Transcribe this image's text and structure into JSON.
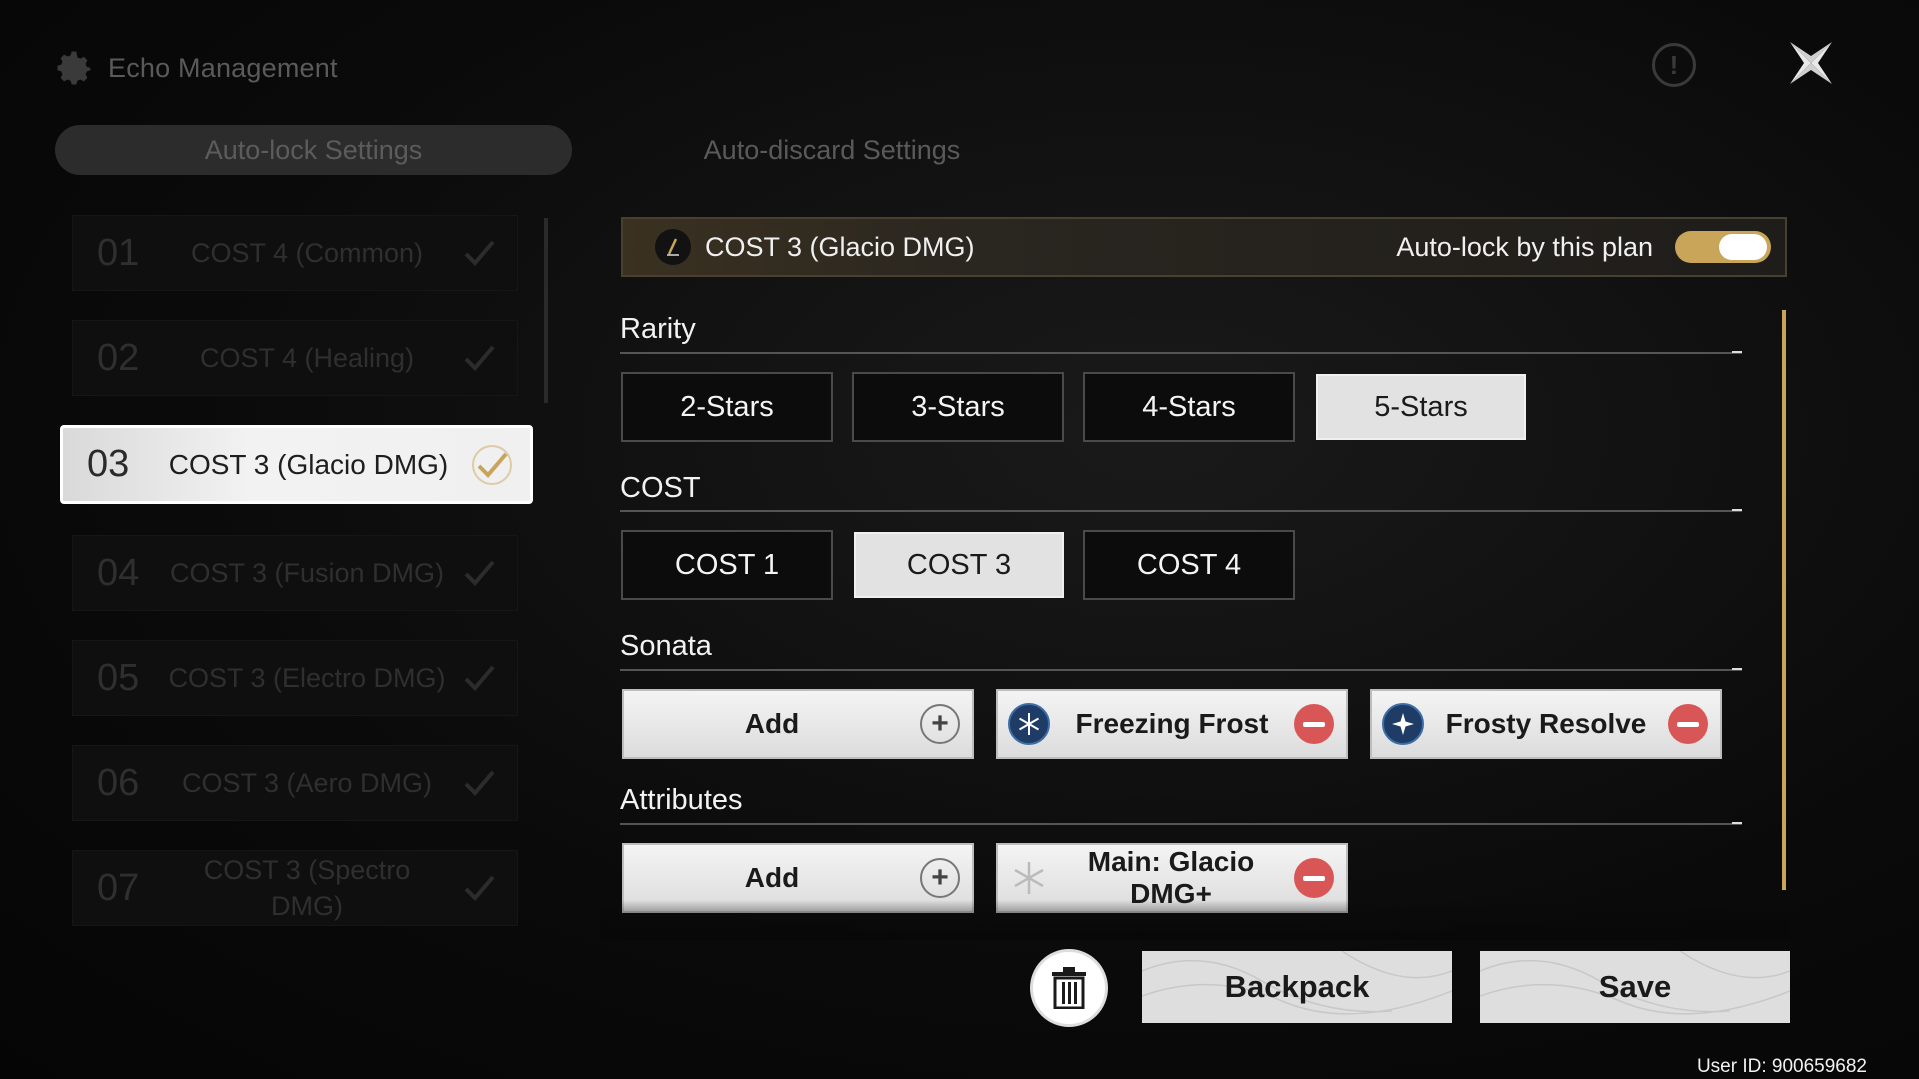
{
  "header": {
    "title": "Echo Management",
    "icon": "gear-icon"
  },
  "tabs": [
    {
      "label": "Auto-lock Settings",
      "active": true
    },
    {
      "label": "Auto-discard Settings",
      "active": false
    }
  ],
  "plans": [
    {
      "num": "01",
      "name": "COST 4 (Common)"
    },
    {
      "num": "02",
      "name": "COST 4 (Healing)"
    },
    {
      "num": "03",
      "name": "COST 3 (Glacio DMG)",
      "active": true
    },
    {
      "num": "04",
      "name": "COST 3 (Fusion DMG)"
    },
    {
      "num": "05",
      "name": "COST 3 (Electro DMG)"
    },
    {
      "num": "06",
      "name": "COST 3 (Aero DMG)"
    },
    {
      "num": "07",
      "name": "COST 3 (Spectro DMG)"
    }
  ],
  "plan_bar": {
    "name": "COST 3 (Glacio DMG)",
    "autolock_label": "Auto-lock by this plan",
    "autolock_on": true
  },
  "sections": {
    "rarity": {
      "title": "Rarity",
      "options": [
        "2-Stars",
        "3-Stars",
        "4-Stars",
        "5-Stars"
      ],
      "selected": "5-Stars"
    },
    "cost": {
      "title": "COST",
      "options": [
        "COST 1",
        "COST 3",
        "COST 4"
      ],
      "selected": "COST 3"
    },
    "sonata": {
      "title": "Sonata",
      "add_label": "Add",
      "items": [
        "Freezing Frost",
        "Frosty Resolve"
      ]
    },
    "attributes": {
      "title": "Attributes",
      "add_label": "Add",
      "items": [
        "Main: Glacio DMG+"
      ]
    }
  },
  "buttons": {
    "backpack": "Backpack",
    "save": "Save"
  },
  "footer": {
    "user_id": "User ID: 900659682"
  },
  "colors": {
    "accent": "#c9a55a",
    "remove": "#d95656",
    "selected_bg": "#e2e2e2"
  }
}
